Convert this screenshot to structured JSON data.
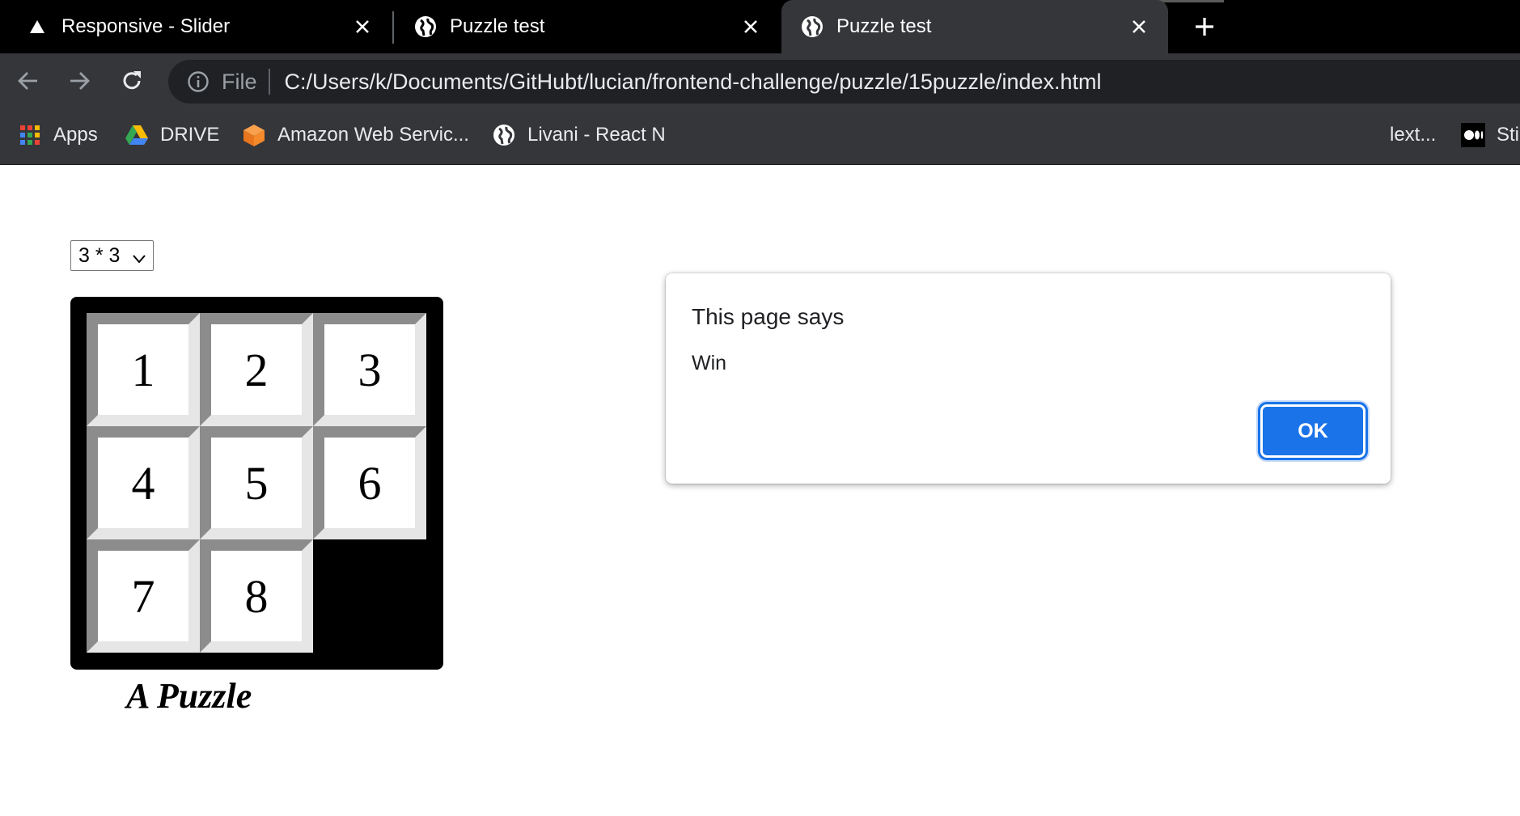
{
  "browser": {
    "tabs": [
      {
        "title": "Responsive - Slider",
        "icon": "drive-triangle-icon",
        "active": false
      },
      {
        "title": "Puzzle test",
        "icon": "globe-icon",
        "active": false
      },
      {
        "title": "Puzzle test",
        "icon": "globe-icon",
        "active": true
      }
    ],
    "address_bar": {
      "scheme_label": "File",
      "url": "C:/Users/k/Documents/GitHubt/lucian/frontend-challenge/puzzle/15puzzle/index.html"
    },
    "bookmarks": [
      {
        "label": "Apps",
        "icon": "apps-grid-icon"
      },
      {
        "label": "DRIVE",
        "icon": "google-drive-icon"
      },
      {
        "label": "Amazon Web Servic...",
        "icon": "aws-cube-icon"
      },
      {
        "label": "Livani - React N",
        "icon": "globe-icon"
      },
      {
        "label": "lext...",
        "icon": "bookmark-icon"
      },
      {
        "label": "Sti",
        "icon": "medium-icon"
      }
    ]
  },
  "page": {
    "size_select": {
      "selected": "3 * 3"
    },
    "board": {
      "tiles": [
        "1",
        "2",
        "3",
        "4",
        "5",
        "6",
        "7",
        "8"
      ]
    },
    "caption": "A Puzzle"
  },
  "dialog": {
    "title": "This page says",
    "message": "Win",
    "ok_label": "OK"
  },
  "colors": {
    "tab_strip_bg": "#000000",
    "toolbar_bg": "#35363a",
    "omnibox_bg": "#202124",
    "accent_blue": "#1a73e8",
    "tile_face": "#ffffff",
    "tile_shadow": "#8c8c8c",
    "tile_highlight": "#e6e6e6"
  }
}
